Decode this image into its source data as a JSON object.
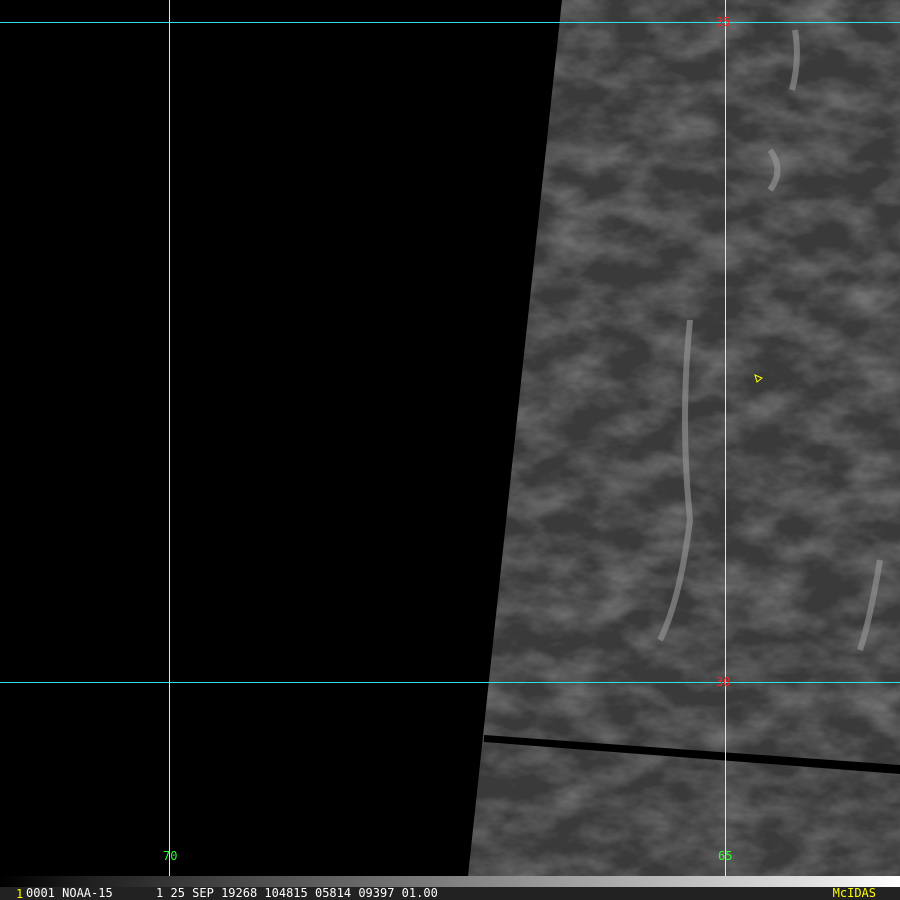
{
  "satellite": "NOAA-15",
  "status": {
    "frame_number": "1",
    "info": "0001 NOAA-15      1 25 SEP 19268 104815 05814 09397 01.00",
    "brand": "McIDAS"
  },
  "grid": {
    "latitudes": [
      "35",
      "30"
    ],
    "longitudes": [
      "70",
      "65"
    ]
  },
  "colors": {
    "lat_line": "#2fe0e0",
    "lat_label": "#ff2020",
    "lon_label": "#30ff30",
    "brand": "#ffff00"
  }
}
